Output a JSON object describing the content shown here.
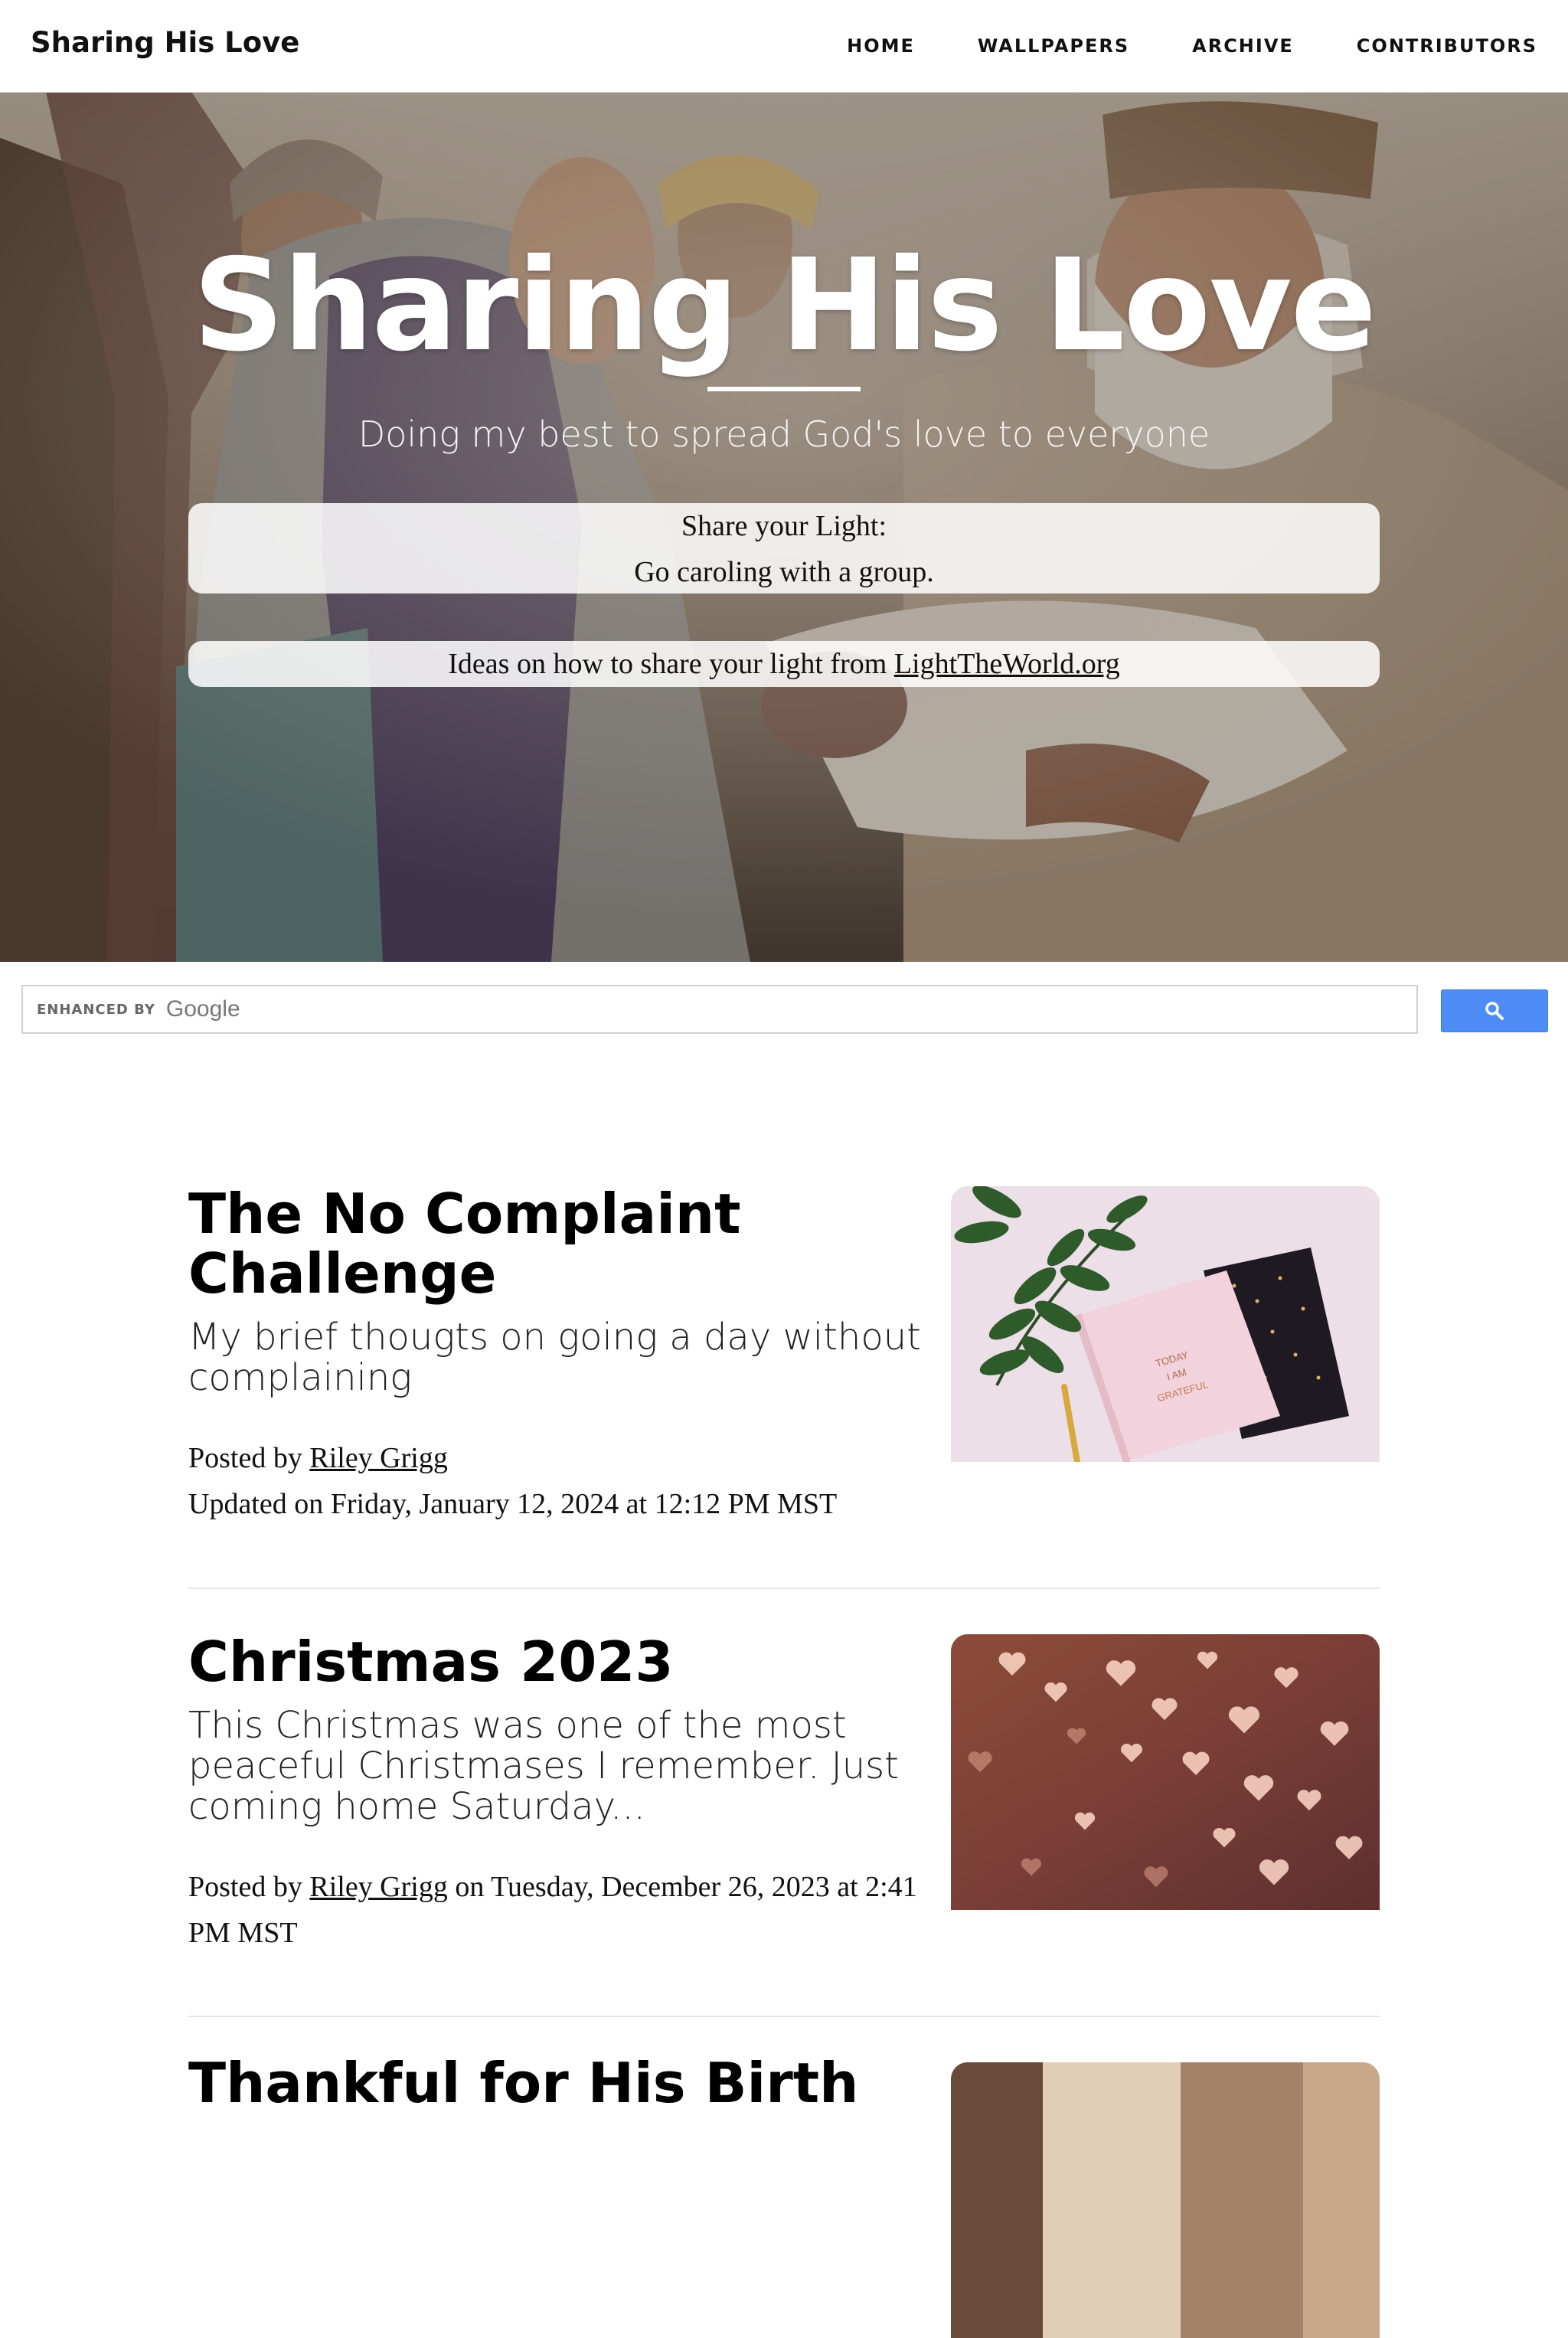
{
  "nav": {
    "brand": "Sharing His Love",
    "links": [
      "HOME",
      "WALLPAPERS",
      "ARCHIVE",
      "CONTRIBUTORS"
    ]
  },
  "hero": {
    "title": "Sharing His Love",
    "subtitle": "Doing my best to spread God's love to everyone",
    "light_box": {
      "line1": "Share your Light:",
      "line2": "Go caroling with a group."
    },
    "ideas": {
      "prefix": "Ideas on how to share your light from ",
      "link": "LightTheWorld.org"
    }
  },
  "search": {
    "enhanced_by": "ENHANCED BY",
    "logo_text": "Google",
    "button_icon": "search-icon"
  },
  "posts": [
    {
      "title": "The No Complaint Challenge",
      "subtitle": "My brief thougts on going a day without complaining",
      "posted_by_prefix": "Posted by ",
      "author": "Riley Grigg",
      "date_text": "Updated on Friday, January 12, 2024 at 12:12 PM MST",
      "thumbnail": "notebook-leaves-image"
    },
    {
      "title": "Christmas 2023",
      "subtitle": "This Christmas was one of the most peaceful Christmases I remember. Just coming home Saturday...",
      "posted_by_prefix": "Posted by ",
      "author": "Riley Grigg",
      "date_text": " on Tuesday, December 26, 2023 at 2:41 PM MST",
      "thumbnail": "bokeh-hearts-image"
    },
    {
      "title": "Thankful for His Birth",
      "thumbnail": "nativity-image"
    }
  ],
  "colors": {
    "search_button": "#4d8df5",
    "divider": "#e6e6e6"
  }
}
